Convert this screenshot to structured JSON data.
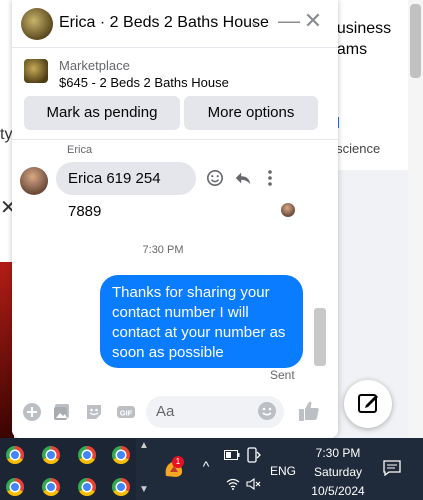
{
  "background": {
    "right_text_1": "business",
    "right_text_2": "eams",
    "right_link": "s.science",
    "left_text": "ty"
  },
  "chat": {
    "header": {
      "title": "Erica · 2 Beds 2 Baths House",
      "chevron_icon": "chevron-down-icon",
      "minimize_icon": "minimize-icon",
      "close_icon": "close-icon"
    },
    "marketplace": {
      "label": "Marketplace",
      "title": "$645 - 2 Beds 2 Baths House",
      "buttons": {
        "pending": "Mark as pending",
        "more": "More options"
      }
    },
    "messages": {
      "sender_name": "Erica",
      "incoming": "Erica 619 254 7889",
      "time": "7:30 PM",
      "outgoing": "Thanks for sharing your contact number I will contact at your number as soon as possible",
      "status": "Sent"
    },
    "composer": {
      "placeholder": "Aa",
      "icons": [
        "plus-icon",
        "image-icon",
        "sticker-icon",
        "gif-icon",
        "emoji-icon",
        "like-icon"
      ]
    },
    "colors": {
      "accent": "#0a7cff",
      "bubble_in": "#e4e6eb"
    }
  },
  "taskbar": {
    "badge_count": "1",
    "language": "ENG",
    "time": "7:30 PM",
    "day": "Saturday",
    "date": "10/5/2024"
  }
}
